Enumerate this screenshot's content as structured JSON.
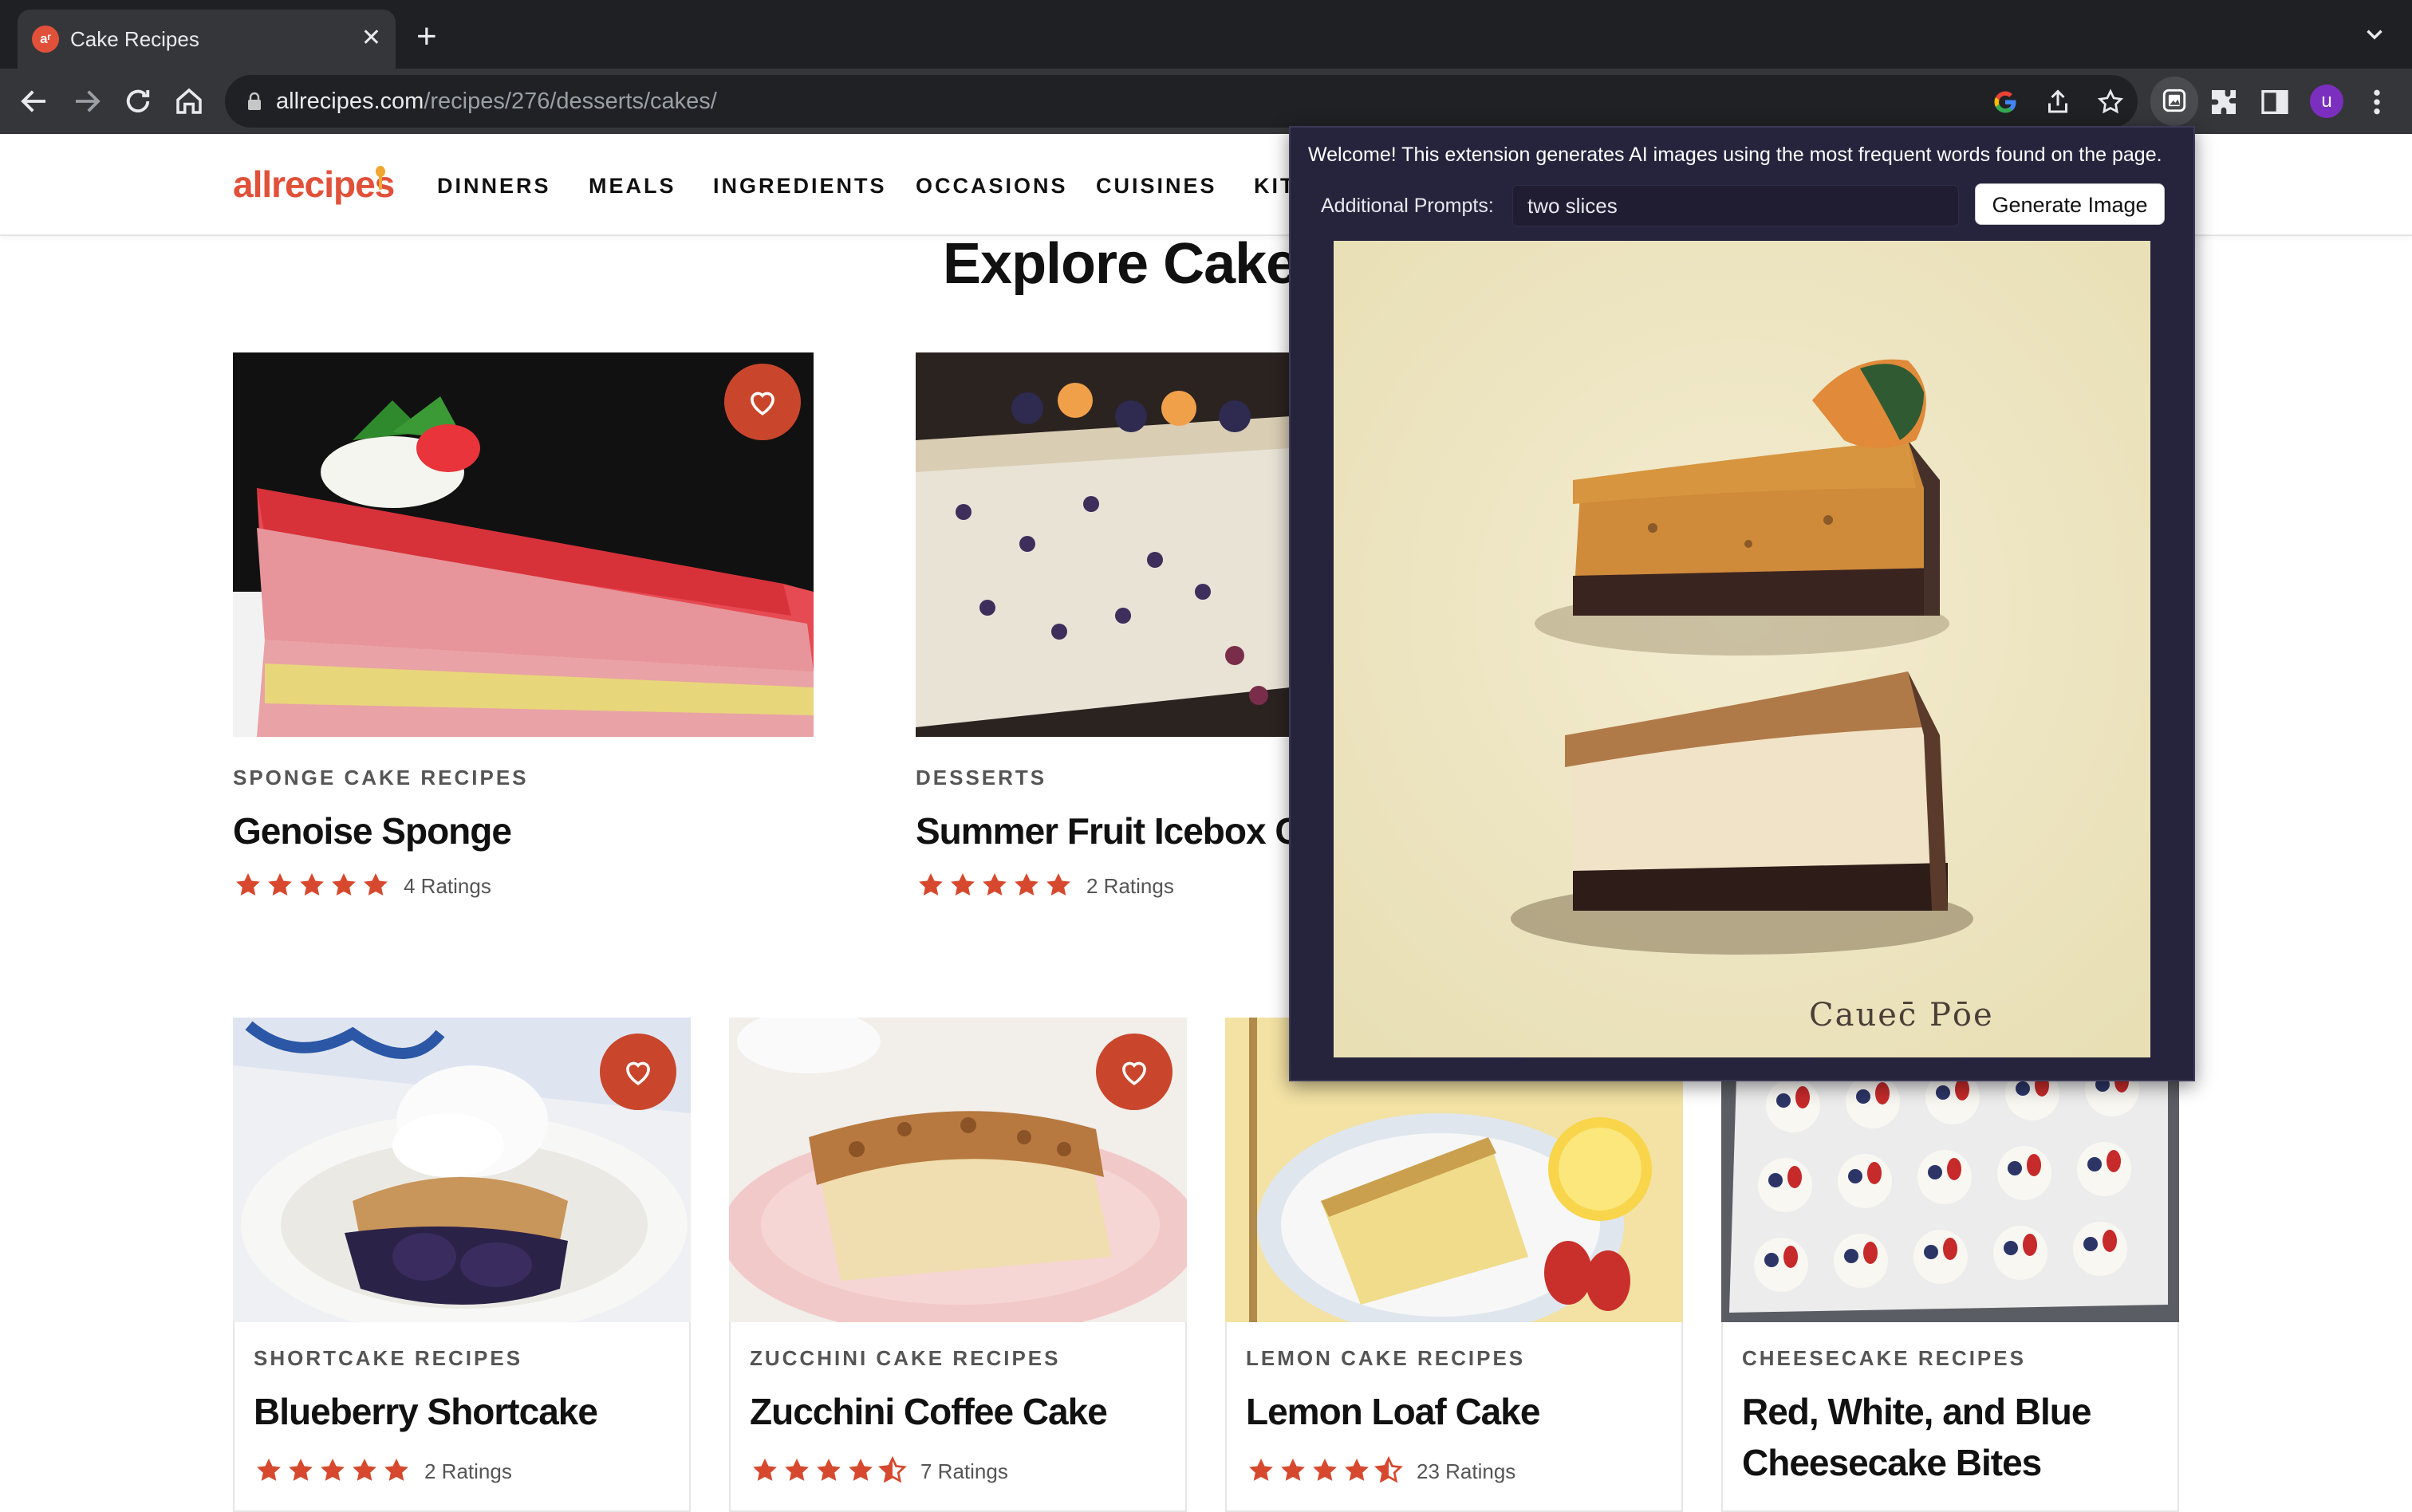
{
  "browser": {
    "tab_title": "Cake Recipes",
    "tab_favicon_text": "aʳ",
    "url_domain": "allrecipes.com",
    "url_path": "/recipes/276/desserts/cakes/",
    "profile_initial": "u"
  },
  "site": {
    "logo": "allrecipes",
    "nav": [
      "DINNERS",
      "MEALS",
      "INGREDIENTS",
      "OCCASIONS",
      "CUISINES",
      "KIT"
    ],
    "heading": "Explore Cake R",
    "accent_color": "#c9462c",
    "star_color": "#d6492e"
  },
  "cards": [
    {
      "category": "SPONGE CAKE RECIPES",
      "title": "Genoise Sponge",
      "rating_text": "4 Ratings",
      "stars": 5
    },
    {
      "category": "DESSERTS",
      "title": "Summer Fruit Icebox C",
      "rating_text": "2 Ratings",
      "stars": 5
    },
    {
      "category": "SHORTCAKE RECIPES",
      "title": "Blueberry Shortcake",
      "rating_text": "2 Ratings",
      "stars": 5
    },
    {
      "category": "ZUCCHINI CAKE RECIPES",
      "title": "Zucchini Coffee Cake",
      "rating_text": "7 Ratings",
      "stars": 4.5
    },
    {
      "category": "LEMON CAKE RECIPES",
      "title": "Lemon Loaf Cake",
      "rating_text": "23 Ratings",
      "stars": 4.5
    },
    {
      "category": "CHEESECAKE RECIPES",
      "title_line1": "Red, White, and Blue",
      "title_line2": "Cheesecake Bites"
    }
  ],
  "extension": {
    "welcome": "Welcome! This extension generates AI images using the most frequent words found on the page.",
    "prompt_label": "Additional Prompts:",
    "prompt_value": "two slices",
    "button_label": "Generate Image",
    "image_caption": "Cauec̄ Pōe"
  }
}
